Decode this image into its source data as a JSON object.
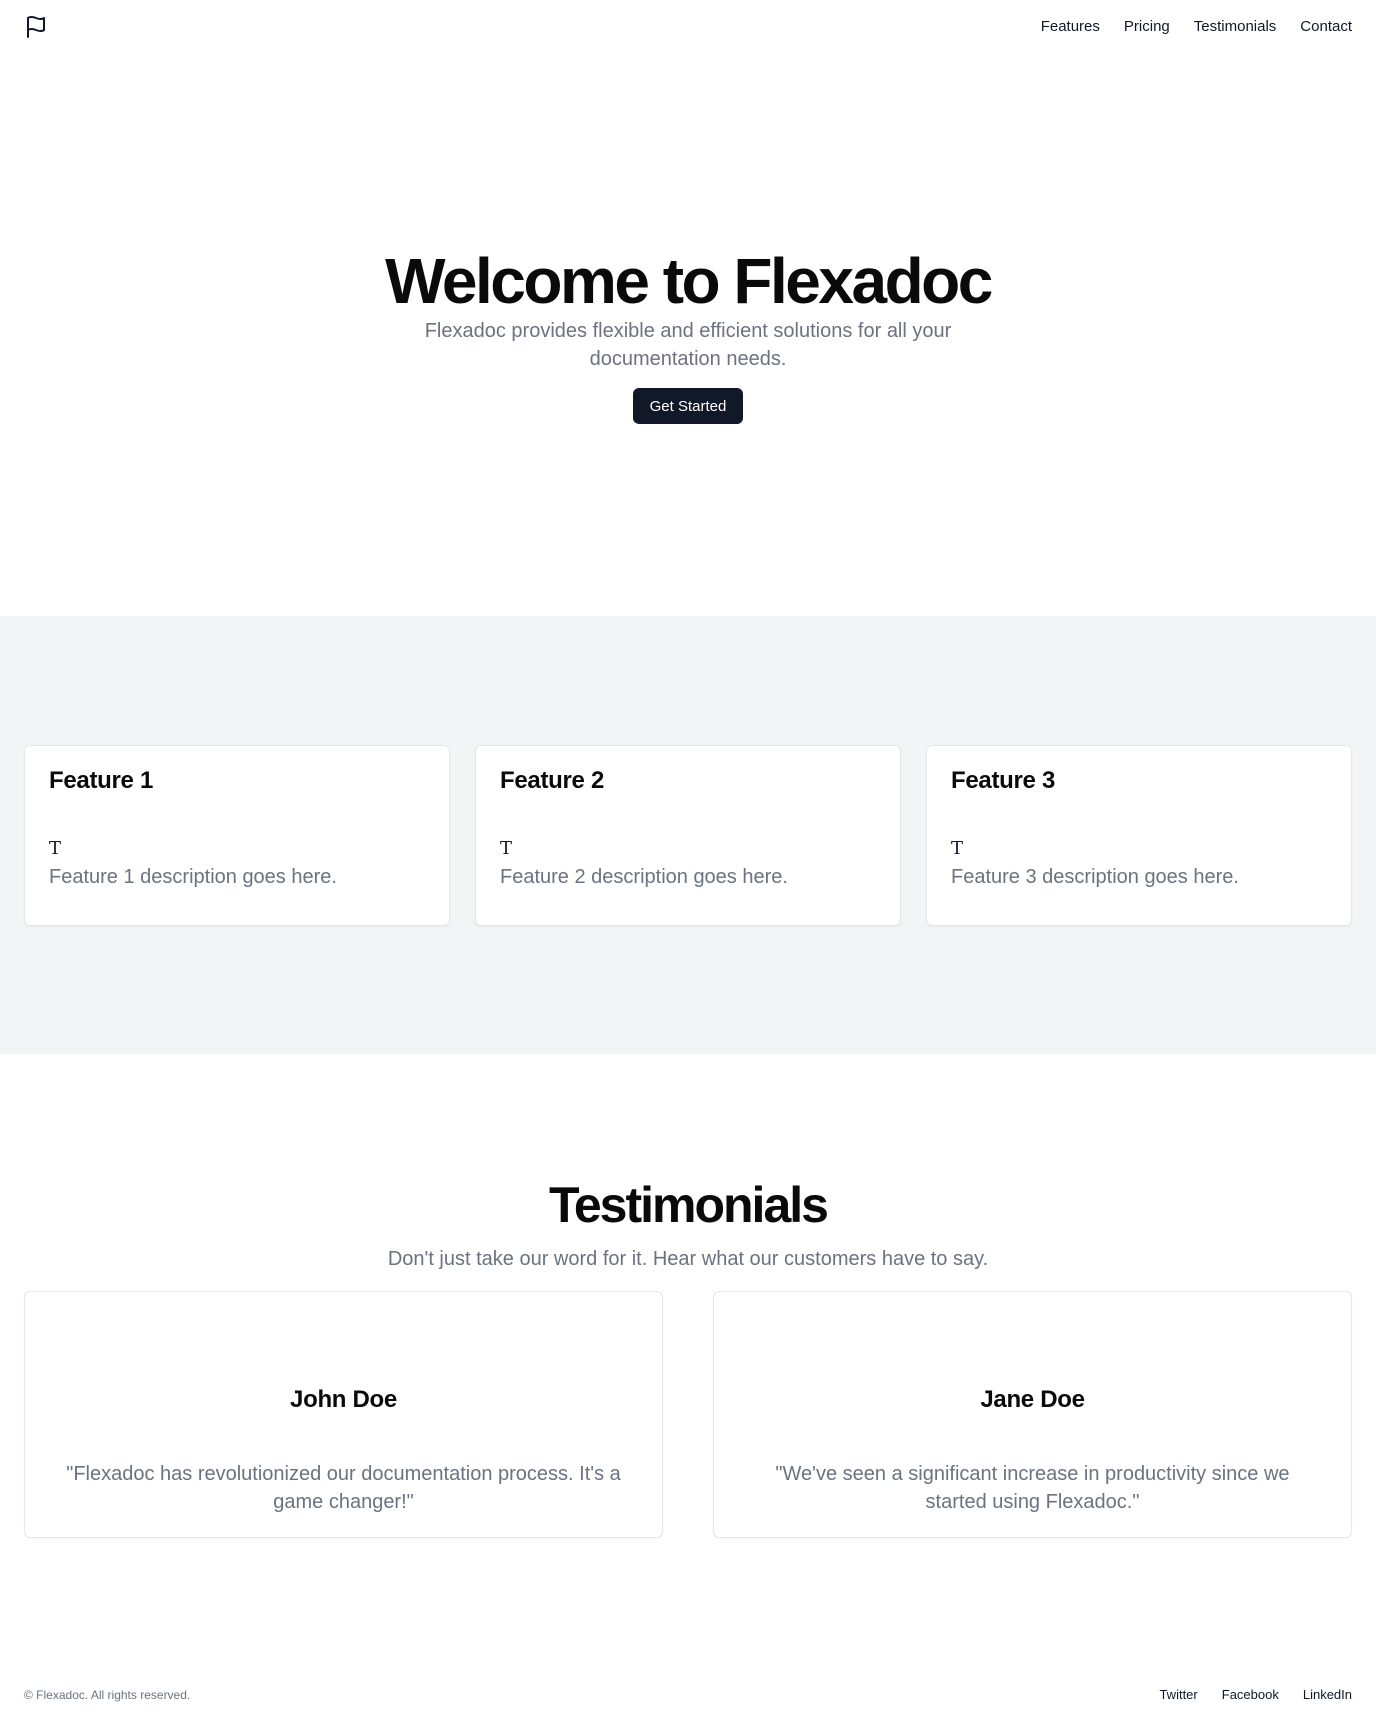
{
  "header": {
    "logo_icon": "flag-icon",
    "nav": [
      "Features",
      "Pricing",
      "Testimonials",
      "Contact"
    ]
  },
  "hero": {
    "title": "Welcome to Flexadoc",
    "subtitle": "Flexadoc provides flexible and efficient solutions for all your documentation needs.",
    "cta_label": "Get Started"
  },
  "features": [
    {
      "title": "Feature 1",
      "icon_glyph": "T",
      "description": "Feature 1 description goes here."
    },
    {
      "title": "Feature 2",
      "icon_glyph": "T",
      "description": "Feature 2 description goes here."
    },
    {
      "title": "Feature 3",
      "icon_glyph": "T",
      "description": "Feature 3 description goes here."
    }
  ],
  "testimonials": {
    "title": "Testimonials",
    "subtitle": "Don't just take our word for it. Hear what our customers have to say.",
    "items": [
      {
        "name": "John Doe",
        "quote": "\"Flexadoc has revolutionized our documentation process. It's a game changer!\""
      },
      {
        "name": "Jane Doe",
        "quote": "\"We've seen a significant increase in productivity since we started using Flexadoc.\""
      }
    ]
  },
  "footer": {
    "copyright": "© Flexadoc. All rights reserved.",
    "links": [
      "Twitter",
      "Facebook",
      "LinkedIn"
    ]
  },
  "colors": {
    "primary_button": "#111827",
    "muted_text": "#6b7280",
    "feature_band_bg": "#f3f4f6",
    "border": "#e5e7eb"
  }
}
